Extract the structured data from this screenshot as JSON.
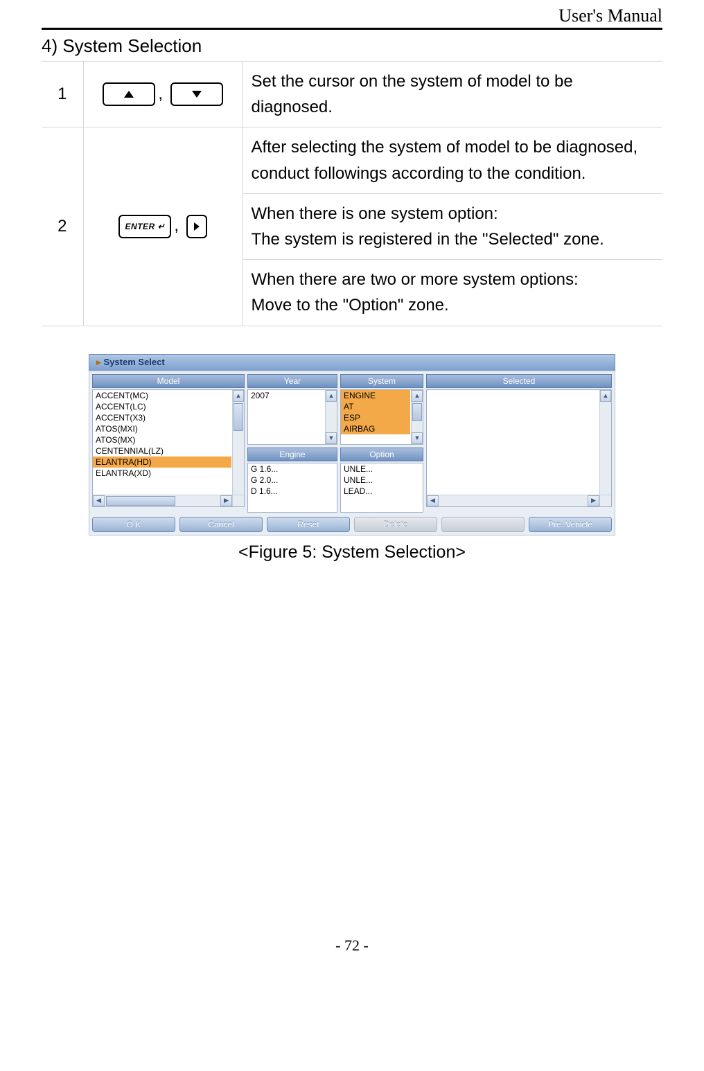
{
  "header": {
    "doc_title": "User's Manual"
  },
  "section": {
    "title": "4) System Selection"
  },
  "table": {
    "row1": {
      "num": "1",
      "desc": "Set the cursor on the system of model to be diagnosed."
    },
    "row2": {
      "num": "2",
      "enter_label": "ENTER ↵",
      "desc_a": "After selecting the system of model to be diagnosed, conduct followings according to the condition.",
      "desc_b": "When there is one system option:\nThe system is registered in the \"Selected\" zone.",
      "desc_c": "When there are two  or more system options:\n Move to the \"Option\" zone."
    }
  },
  "screenshot": {
    "title": "System Select",
    "headers": {
      "model": "Model",
      "year": "Year",
      "system": "System",
      "selected": "Selected",
      "engine": "Engine",
      "option": "Option"
    },
    "model_items": [
      "ACCENT(MC)",
      "ACCENT(LC)",
      "ACCENT(X3)",
      "ATOS(MXI)",
      "ATOS(MX)",
      "CENTENNIAL(LZ)",
      "ELANTRA(HD)",
      "ELANTRA(XD)"
    ],
    "model_selected_index": 6,
    "year_items": [
      "2007"
    ],
    "system_items": [
      "ENGINE",
      "AT",
      "ESP",
      "AIRBAG"
    ],
    "engine_items": [
      "G 1.6...",
      "G 2.0...",
      "D 1.6..."
    ],
    "option_items": [
      "UNLE...",
      "UNLE...",
      "LEAD..."
    ],
    "buttons": {
      "ok": "O K",
      "cancel": "Cancel",
      "reset": "Reset",
      "delete": "Delete",
      "blank": "",
      "pre": "Pre. Vehicle"
    }
  },
  "caption": "<Figure 5: System Selection>",
  "footer": {
    "page": "- 72 -"
  }
}
